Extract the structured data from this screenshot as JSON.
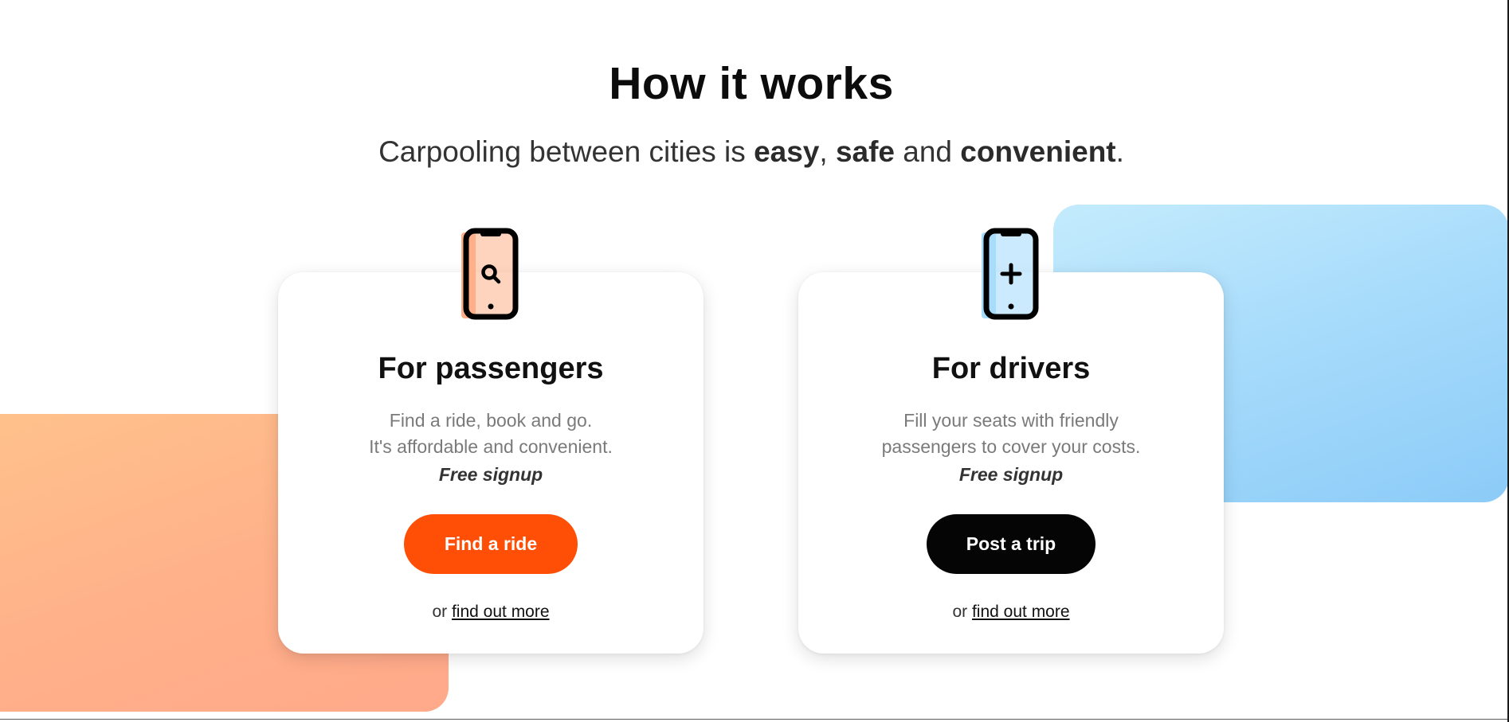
{
  "section": {
    "title": "How it works",
    "subtitle_parts": [
      {
        "text": "Carpooling between cities is ",
        "bold": false
      },
      {
        "text": "easy",
        "bold": true
      },
      {
        "text": ", ",
        "bold": false
      },
      {
        "text": "safe",
        "bold": true
      },
      {
        "text": " and ",
        "bold": false
      },
      {
        "text": "convenient",
        "bold": true
      },
      {
        "text": ".",
        "bold": false
      }
    ]
  },
  "cards": {
    "passengers": {
      "icon": "phone-search-icon",
      "title": "For passengers",
      "desc_line1": "Find a ride, book and go.",
      "desc_line2": "It's affordable and convenient.",
      "free_label": "Free signup",
      "button_label": "Find a ride",
      "or_text": "or",
      "more_link": "find out more"
    },
    "drivers": {
      "icon": "phone-plus-icon",
      "title": "For drivers",
      "desc_line1": "Fill your seats with friendly",
      "desc_line2": "passengers to cover your costs.",
      "free_label": "Free signup",
      "button_label": "Post a trip",
      "or_text": "or",
      "more_link": "find out more"
    }
  },
  "colors": {
    "accent_orange": "#ff4f06",
    "button_black": "#050505",
    "deco_orange": "#ffb089",
    "deco_blue": "#a8dcfb"
  }
}
